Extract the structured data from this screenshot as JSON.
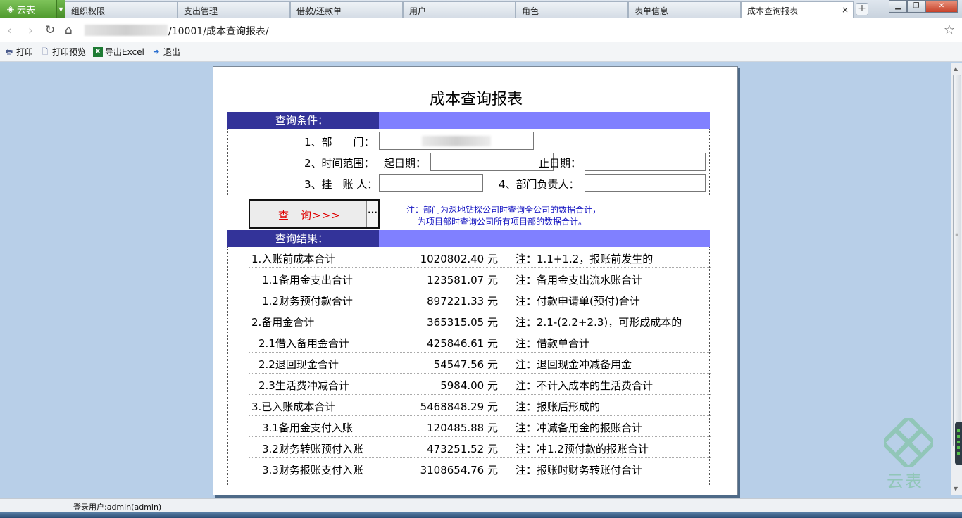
{
  "browser": {
    "brand": "云表",
    "tabs": [
      {
        "label": "组织权限",
        "active": false
      },
      {
        "label": "支出管理",
        "active": false
      },
      {
        "label": "借款/还款单",
        "active": false
      },
      {
        "label": "用户",
        "active": false
      },
      {
        "label": "角色",
        "active": false
      },
      {
        "label": "表单信息",
        "active": false
      },
      {
        "label": "成本查询报表",
        "active": true
      }
    ],
    "close_tab_label": "×",
    "new_tab_label": "+",
    "address": "/10001/成本查询报表/"
  },
  "toolbar": {
    "print": "打印",
    "print_preview": "打印预览",
    "export_excel": "导出Excel",
    "exit": "退出"
  },
  "report": {
    "title": "成本查询报表",
    "conditions_header": "查询条件：",
    "fields": {
      "department_label": "1、部　　门：",
      "time_range_label": "2、时间范围：",
      "start_date_label": "起日期：",
      "end_date_label": "止日期：",
      "account_person_label": "3、挂　账 人：",
      "dept_head_label": "4、部门负责人："
    },
    "query_button": "查　询>>>",
    "query_more": "···",
    "note_line1": "注：部门为深地钻探公司时查询全公司的数据合计，",
    "note_line2": "为项目部时查询公司所有项目部的数据合计。",
    "results_header": "查询结果：",
    "rows": [
      {
        "name": "1.入账前成本合计",
        "value": "1020802.40 元",
        "note": "注：1.1+1.2，报账前发生的",
        "indent": 0
      },
      {
        "name": "1.1备用金支出合计",
        "value": "123581.07 元",
        "note": "注：备用金支出流水账合计",
        "indent": 2
      },
      {
        "name": "1.2财务预付款合计",
        "value": "897221.33 元",
        "note": "注：付款申请单(预付)合计",
        "indent": 2
      },
      {
        "name": "2.备用金合计",
        "value": "365315.05 元",
        "note": "注：2.1-(2.2+2.3)，可形成成本的",
        "indent": 0
      },
      {
        "name": "2.1借入备用金合计",
        "value": "425846.61 元",
        "note": "注：借款单合计",
        "indent": 1
      },
      {
        "name": "2.2退回现金合计",
        "value": "54547.56 元",
        "note": "注：退回现金冲减备用金",
        "indent": 1
      },
      {
        "name": "2.3生活费冲减合计",
        "value": "5984.00 元",
        "note": "注：不计入成本的生活费合计",
        "indent": 1
      },
      {
        "name": "3.已入账成本合计",
        "value": "5468848.29 元",
        "note": "注：报账后形成的",
        "indent": 0
      },
      {
        "name": "3.1备用金支付入账",
        "value": "120485.88 元",
        "note": "注：冲减备用金的报账合计",
        "indent": 2
      },
      {
        "name": "3.2财务转账预付入账",
        "value": "473251.52 元",
        "note": "注：冲1.2预付款的报账合计",
        "indent": 2
      },
      {
        "name": "3.3财务报账支付入账",
        "value": "3108654.76 元",
        "note": "注：报账时财务转账付合计",
        "indent": 2
      }
    ]
  },
  "watermark": "云表",
  "status": {
    "login_user": "登录用户:admin(admin)"
  },
  "colors": {
    "section_label_bg": "#333399",
    "section_bar_bg": "#8080ff",
    "query_text": "#e00000",
    "note_text": "#1010c0",
    "brand_green": "#5ba83a"
  }
}
